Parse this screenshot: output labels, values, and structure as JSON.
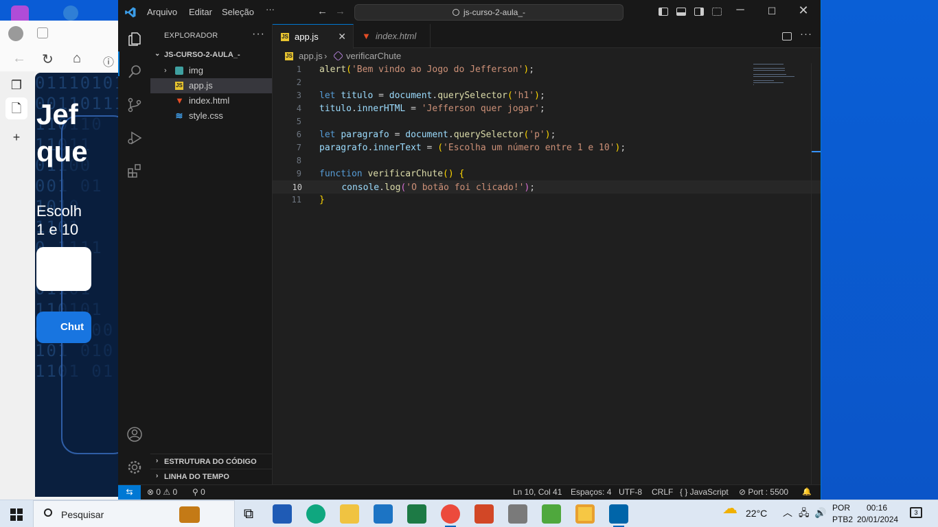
{
  "browser": {
    "binary_rows": [
      "01110101",
      "00110111",
      "110110",
      "11011",
      "01100",
      "001 01",
      "1010",
      "1101",
      "0 1111",
      "1010",
      "01101",
      "110101",
      "0110 00",
      "101 010",
      "1101 01"
    ],
    "page_heading": "Jef\nque",
    "page_text": "Escolh\n1 e 10",
    "button_label": "Chut"
  },
  "titlebar": {
    "menus": [
      "Arquivo",
      "Editar",
      "Seleção",
      "···"
    ],
    "command_center": "js-curso-2-aula_-"
  },
  "sidebar": {
    "title": "EXPLORADOR",
    "more": "···",
    "folder": "JS-CURSO-2-AULA_-",
    "items": [
      {
        "label": "img",
        "type": "folder"
      },
      {
        "label": "app.js",
        "type": "js",
        "icon_text": "JS"
      },
      {
        "label": "index.html",
        "type": "html"
      },
      {
        "label": "style.css",
        "type": "css"
      }
    ],
    "sections": [
      "ESTRUTURA DO CÓDIGO",
      "LINHA DO TEMPO"
    ]
  },
  "tabs": [
    {
      "label": "app.js",
      "icon_text": "JS",
      "active": true
    },
    {
      "label": "index.html",
      "active": false
    }
  ],
  "breadcrumb": {
    "file": "app.js",
    "icon_text": "JS",
    "symbol": "verificarChute"
  },
  "code": {
    "current_line": 10,
    "lines": [
      [
        [
          "fn",
          "alert"
        ],
        [
          "pa",
          "("
        ],
        [
          "str",
          "'Bem vindo ao Jogo do Jefferson'"
        ],
        [
          "pa",
          ")"
        ],
        [
          "t",
          ";"
        ]
      ],
      [],
      [
        [
          "kw",
          "let"
        ],
        [
          "t",
          " "
        ],
        [
          "var",
          "titulo"
        ],
        [
          "t",
          " = "
        ],
        [
          "var",
          "document"
        ],
        [
          "t",
          "."
        ],
        [
          "fn",
          "querySelector"
        ],
        [
          "pa",
          "("
        ],
        [
          "str",
          "'h1'"
        ],
        [
          "pa",
          ")"
        ],
        [
          "t",
          ";"
        ]
      ],
      [
        [
          "var",
          "titulo"
        ],
        [
          "t",
          "."
        ],
        [
          "prop",
          "innerHTML"
        ],
        [
          "t",
          " = "
        ],
        [
          "str",
          "'Jefferson quer jogar'"
        ],
        [
          "t",
          ";"
        ]
      ],
      [],
      [
        [
          "kw",
          "let"
        ],
        [
          "t",
          " "
        ],
        [
          "var",
          "paragrafo"
        ],
        [
          "t",
          " = "
        ],
        [
          "var",
          "document"
        ],
        [
          "t",
          "."
        ],
        [
          "fn",
          "querySelector"
        ],
        [
          "pa",
          "("
        ],
        [
          "str",
          "'p'"
        ],
        [
          "pa",
          ")"
        ],
        [
          "t",
          ";"
        ]
      ],
      [
        [
          "var",
          "paragrafo"
        ],
        [
          "t",
          "."
        ],
        [
          "prop",
          "innerText"
        ],
        [
          "t",
          " = "
        ],
        [
          "pa",
          "("
        ],
        [
          "str",
          "'Escolha um número entre 1 e 10'"
        ],
        [
          "pa",
          ")"
        ],
        [
          "t",
          ";"
        ]
      ],
      [],
      [
        [
          "kw",
          "function"
        ],
        [
          "t",
          " "
        ],
        [
          "fn",
          "verificarChute"
        ],
        [
          "pa",
          "()"
        ],
        [
          "t",
          " "
        ],
        [
          "pa",
          "{"
        ]
      ],
      [
        [
          "t",
          "    "
        ],
        [
          "var",
          "console"
        ],
        [
          "t",
          "."
        ],
        [
          "fn",
          "log"
        ],
        [
          "pb",
          "("
        ],
        [
          "str",
          "'O botão foi clicado!'"
        ],
        [
          "pb",
          ")"
        ],
        [
          "t",
          ";"
        ]
      ],
      [
        [
          "pa",
          "}"
        ]
      ]
    ]
  },
  "statusbar": {
    "remote": "⇆",
    "problems": "⊗ 0 ⚠ 0",
    "ports": "⚲ 0",
    "position": "Ln 10, Col 41",
    "spaces": "Espaços: 4",
    "encoding": "UTF-8",
    "eol": "CRLF",
    "language": "{ } JavaScript",
    "port": "⊘ Port : 5500",
    "bell": "🔔"
  },
  "taskbar": {
    "search_label": "Pesquisar",
    "weather": "22°C",
    "lang_top": "POR",
    "lang_bottom": "PTB2",
    "time": "00:16",
    "date": "20/01/2024",
    "notification_count": "3"
  },
  "colors": {
    "accent": "#0078d4",
    "editor_bg": "#1f1f1f",
    "sidebar_bg": "#181818"
  }
}
